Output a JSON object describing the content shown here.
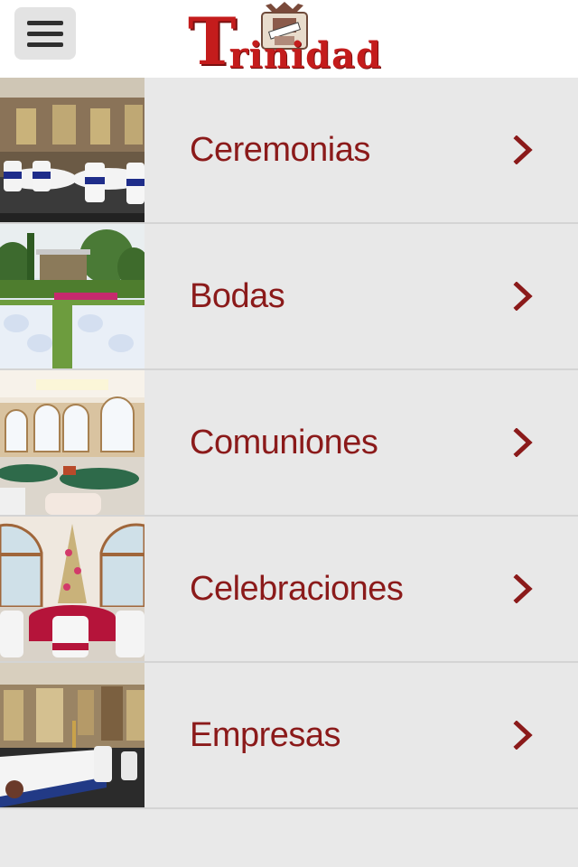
{
  "header": {
    "menu_icon": "hamburger-menu-icon",
    "logo": {
      "text_big": "T",
      "text_rest": "rinidad",
      "alt": "Trinidad"
    }
  },
  "menu": {
    "items": [
      {
        "label": "Ceremonias",
        "icon": "chevron-right-icon"
      },
      {
        "label": "Bodas",
        "icon": "chevron-right-icon"
      },
      {
        "label": "Comuniones",
        "icon": "chevron-right-icon"
      },
      {
        "label": "Celebraciones",
        "icon": "chevron-right-icon"
      },
      {
        "label": "Empresas",
        "icon": "chevron-right-icon"
      }
    ]
  },
  "colors": {
    "label": "#8b1a1a",
    "logo": "#c41c1c",
    "row_bg": "#e8e8e8",
    "divider": "#d4d4d4"
  }
}
